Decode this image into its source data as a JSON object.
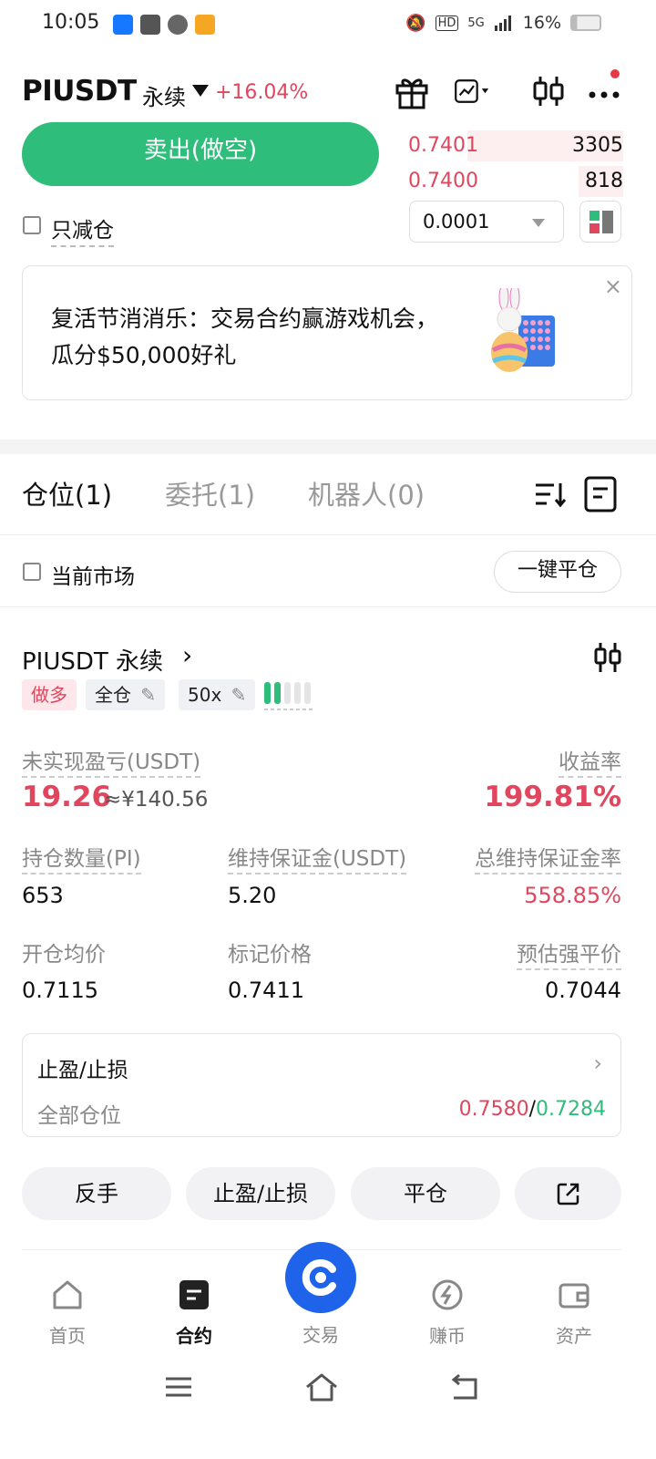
{
  "status_bar": {
    "time": "10:05",
    "battery": "16%",
    "network": "5G"
  },
  "header": {
    "pair": "PIUSDT",
    "contract_type": "永续",
    "change": "+16.04%"
  },
  "order_panel": {
    "sell_label": "卖出(做空)",
    "reduce_only_label": "只减仓",
    "tick_size": "0.0001",
    "orderbook": [
      {
        "price": "0.7401",
        "qty": "3305",
        "depth": 0.7
      },
      {
        "price": "0.7400",
        "qty": "818",
        "depth": 0.2
      }
    ]
  },
  "banner": {
    "text": "复活节消消乐：交易合约赢游戏机会，瓜分$50,000好礼",
    "close": "×"
  },
  "tabs": [
    {
      "label": "仓位(1)"
    },
    {
      "label": "委托(1)"
    },
    {
      "label": "机器人(0)"
    }
  ],
  "filters": {
    "current_market_label": "当前市场",
    "close_all_label": "一键平仓"
  },
  "position": {
    "title": "PIUSDT 永续",
    "side": "做多",
    "margin_mode": "全仓",
    "leverage": "50x",
    "leverage_bars_filled": 2,
    "unrealized_pnl_label": "未实现盈亏(USDT)",
    "unrealized_pnl": "19.26",
    "unrealized_pnl_cny": "≈¥140.56",
    "roe_label": "收益率",
    "roe": "199.81%",
    "size_label": "持仓数量(PI)",
    "size": "653",
    "maint_margin_label": "维持保证金(USDT)",
    "maint_margin": "5.20",
    "maint_ratio_label": "总维持保证金率",
    "maint_ratio": "558.85%",
    "entry_label": "开仓均价",
    "entry": "0.7115",
    "mark_label": "标记价格",
    "mark": "0.7411",
    "liq_label": "预估强平价",
    "liq": "0.7044",
    "tpsl_title": "止盈/止损",
    "tpsl_scope": "全部仓位",
    "tp": "0.7580",
    "sl": "0.7284",
    "tpsl_sep": "/"
  },
  "actions": {
    "reverse": "反手",
    "tpsl": "止盈/止损",
    "close": "平仓"
  },
  "bottom_nav": [
    {
      "label": "首页",
      "icon": "home-icon"
    },
    {
      "label": "合约",
      "icon": "contract-icon"
    },
    {
      "label": "交易",
      "icon": "trade-icon"
    },
    {
      "label": "赚币",
      "icon": "earn-icon"
    },
    {
      "label": "资产",
      "icon": "wallet-icon"
    }
  ],
  "colors": {
    "up": "#2ebd7a",
    "down": "#e0465e",
    "brand": "#1e63e9"
  }
}
